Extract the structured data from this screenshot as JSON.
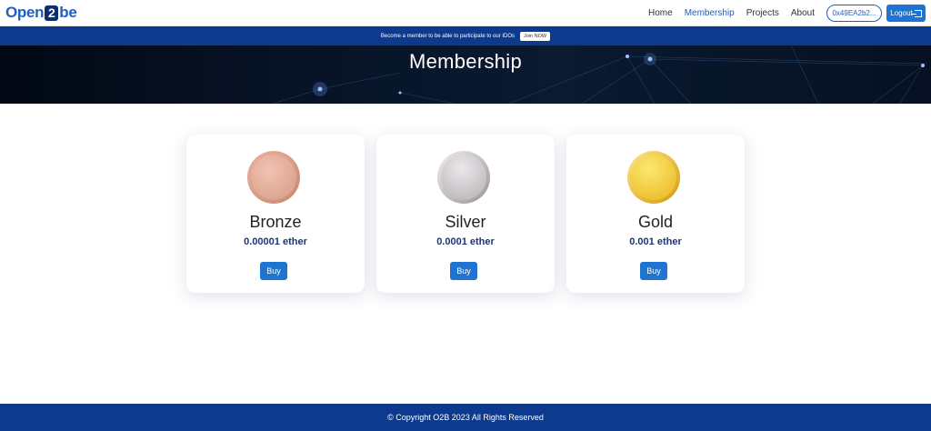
{
  "header": {
    "logo": {
      "left": "Open",
      "middle": "2",
      "right": "be"
    },
    "nav": [
      "Home",
      "Membership",
      "Projects",
      "About"
    ],
    "active_nav": "Membership",
    "wallet_address": "0x49EA2b2...",
    "logout_label": "Logout",
    "logout_icon": "logout-icon"
  },
  "member_bar": {
    "text": "Become a member to be able to participate to our IDOs",
    "join_label": "Join NOW"
  },
  "hero": {
    "title": "Membership"
  },
  "tiers": [
    {
      "name": "Bronze",
      "price": "0.00001 ether",
      "buy_label": "Buy",
      "coin": "bronze-coin-icon"
    },
    {
      "name": "Silver",
      "price": "0.0001 ether",
      "buy_label": "Buy",
      "coin": "silver-coin-icon"
    },
    {
      "name": "Gold",
      "price": "0.001 ether",
      "buy_label": "Buy",
      "coin": "gold-coin-icon"
    }
  ],
  "footer": {
    "copyright": "© Copyright O2B 2023 All Rights Reserved"
  },
  "colors": {
    "brand_blue": "#1f74d1",
    "navy": "#0d3a8c",
    "price_text": "#1e3670"
  }
}
